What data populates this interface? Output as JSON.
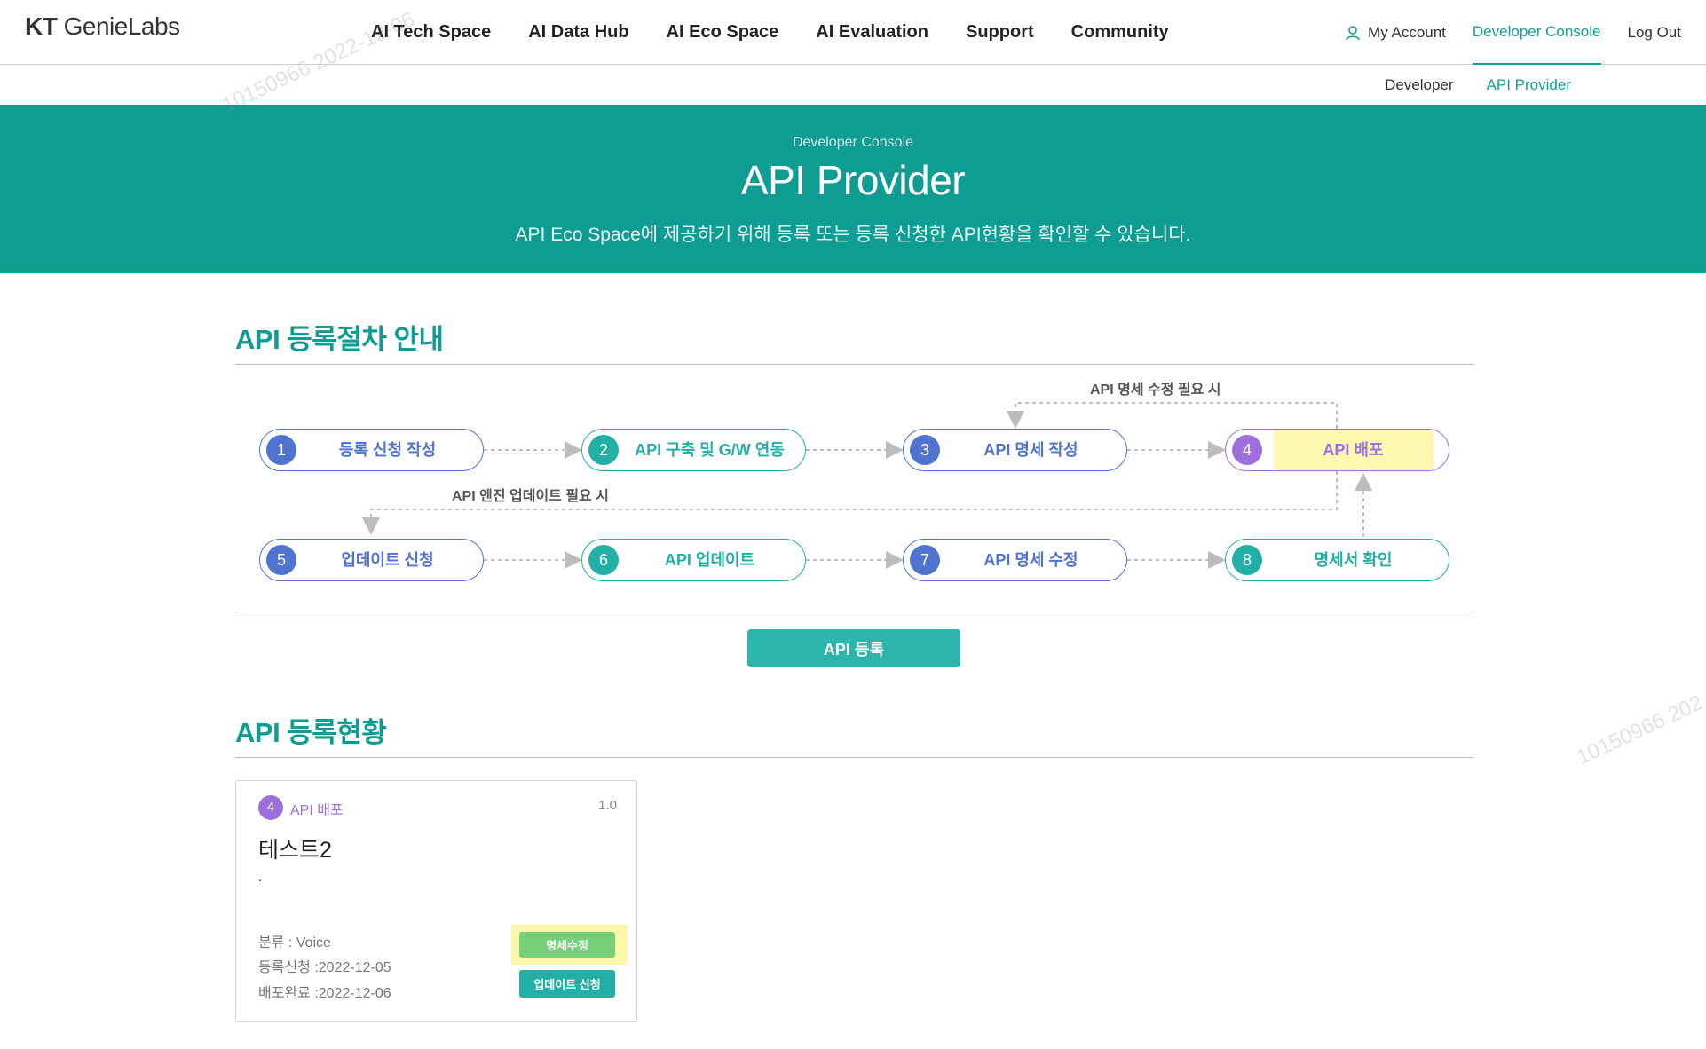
{
  "header": {
    "logo_prefix": "KT",
    "logo_suffix": "GenieLabs",
    "nav": [
      "AI Tech Space",
      "AI Data Hub",
      "AI Eco Space",
      "AI Evaluation",
      "Support",
      "Community"
    ],
    "util": {
      "my_account": "My Account",
      "developer_console": "Developer Console",
      "logout": "Log Out"
    },
    "subnav": {
      "developer": "Developer",
      "api_provider": "API Provider"
    }
  },
  "hero": {
    "eyebrow": "Developer Console",
    "title": "API Provider",
    "description": "API Eco Space에 제공하기 위해 등록 또는 등록 신청한 API현황을 확인할 수 있습니다."
  },
  "process": {
    "section_title": "API 등록절차 안내",
    "note_spec": "API 명세 수정 필요 시",
    "note_engine": "API 엔진 업데이트 필요 시",
    "steps": [
      {
        "num": "1",
        "label": "등록 신청 작성"
      },
      {
        "num": "2",
        "label": "API 구축 및 G/W 연동"
      },
      {
        "num": "3",
        "label": "API 명세 작성"
      },
      {
        "num": "4",
        "label": "API 배포"
      },
      {
        "num": "5",
        "label": "업데이트 신청"
      },
      {
        "num": "6",
        "label": "API 업데이트"
      },
      {
        "num": "7",
        "label": "API 명세 수정"
      },
      {
        "num": "8",
        "label": "명세서 확인"
      }
    ],
    "register_button": "API 등록"
  },
  "status": {
    "section_title": "API 등록현황",
    "cards": [
      {
        "step_num": "4",
        "step_label": "API 배포",
        "version": "1.0",
        "title": "테스트2",
        "description": ".",
        "category": "분류 : Voice",
        "requested": "등록신청 :2022-12-05",
        "deployed": "배포완료 :2022-12-06",
        "edit_button": "명세수정",
        "update_button": "업데이트 신청"
      }
    ]
  },
  "watermarks": [
    "10150966 2022-12-06",
    "10150966 202"
  ],
  "colors": {
    "primary": "#0e9c93",
    "teal_step": "#22b0a6",
    "blue_step": "#4f73cf",
    "purple_step": "#9c6fdc",
    "highlight": "#fcf8b0",
    "edit_button": "#77cf7a"
  },
  "icons": {
    "my_account": "user-icon"
  }
}
